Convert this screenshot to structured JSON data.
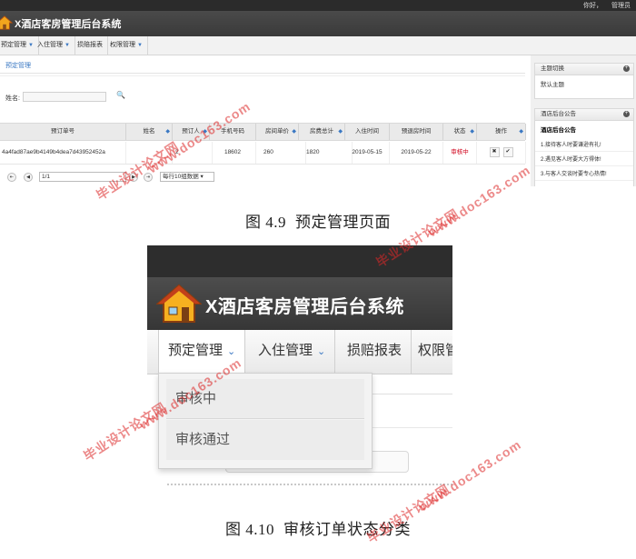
{
  "figure1": {
    "top_user": [
      "你好，",
      "管理员"
    ],
    "app_title": "X酒店客房管理后台系统",
    "nav": [
      {
        "label": "预定管理"
      },
      {
        "label": "入住管理"
      },
      {
        "label": "损赔报表"
      },
      {
        "label": "权限管理"
      }
    ],
    "section_title": "预定管理",
    "search": {
      "label": "姓名:",
      "value": ""
    },
    "table": {
      "headers": [
        "预订单号",
        "姓名",
        "预订人",
        "手机号码",
        "房间单价",
        "房费总计",
        "入住时间",
        "预退房时间",
        "状态",
        "操作"
      ],
      "rows": [
        {
          "order": "4a4fad87ae9b4149b4dea7d43952452a",
          "name": "",
          "booker": "2",
          "phone": "18602",
          "price": "260",
          "total": "1820",
          "checkin": "2019-05-15",
          "checkout": "2019-05-22",
          "status": "审核中"
        }
      ],
      "action_icons": [
        "close-icon",
        "check-icon"
      ]
    },
    "pager": {
      "page": "1/1",
      "size_label": "每行10组数据"
    },
    "sidebar": {
      "theme_title": "主题切换",
      "theme_value": "默认主题",
      "notice_title": "酒店后台公告",
      "notice_heading": "酒店后台公告",
      "notices": [
        "1.接待客人时要谦逊有礼!",
        "2.遇见客人时要大方得体!",
        "3.与客人交谈时要专心热情!"
      ]
    }
  },
  "caption1": {
    "num": "图 4.9",
    "text": "预定管理页面"
  },
  "figure2": {
    "app_title": "X酒店客房管理后台系统",
    "nav": [
      {
        "label": "预定管理"
      },
      {
        "label": "入住管理"
      },
      {
        "label": "损赔报表"
      },
      {
        "label": "权限管"
      }
    ],
    "dropdown": [
      "审核中",
      "审核通过"
    ]
  },
  "caption2": {
    "num": "图 4.10",
    "text": "审核订单状态分类"
  },
  "watermark": {
    "text1": "毕业设计论文网",
    "text2": "www.doc163.com"
  },
  "colors": {
    "accent": "#3a78c3",
    "status_pending": "#d0021b",
    "watermark": "#dc2828"
  }
}
